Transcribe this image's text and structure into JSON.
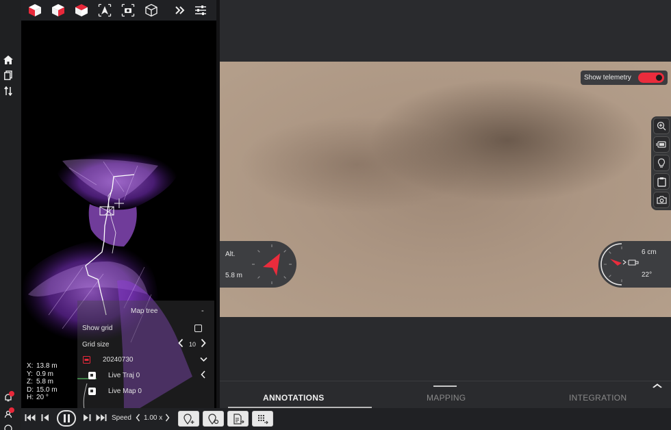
{
  "toolbar": {
    "icons": [
      "cube-red-left-icon",
      "cube-red-right-icon",
      "cube-red-top-icon",
      "navigation-arrow-icon",
      "camera-icon",
      "cube-outline-icon",
      "double-chevron-right-icon",
      "sliders-icon"
    ]
  },
  "map_tree": {
    "title": "Map tree",
    "collapse_symbol": "-",
    "show_grid_label": "Show grid",
    "grid_size_label": "Grid size",
    "grid_size_value": "10",
    "date_node": "20240730",
    "layers": [
      "Live Traj 0",
      "Live Map 0"
    ]
  },
  "coords": [
    {
      "k": "X:",
      "v": "13.8 m"
    },
    {
      "k": "Y:",
      "v": "0.9 m"
    },
    {
      "k": "Z:",
      "v": "5.8 m"
    },
    {
      "k": "D:",
      "v": "15.0 m"
    },
    {
      "k": "H:",
      "v": "20 °"
    }
  ],
  "telemetry": {
    "label": "Show telemetry",
    "enabled": true,
    "altitude_label": "Alt.",
    "altitude_value": "5.8 m",
    "distance_value": "6 cm",
    "angle_value": "22°"
  },
  "tabs": [
    {
      "label": "ANNOTATIONS",
      "active": true
    },
    {
      "label": "MAPPING",
      "active": false
    },
    {
      "label": "INTEGRATION",
      "active": false
    }
  ],
  "playback": {
    "speed_label": "Speed",
    "speed_value": "1.00 x"
  },
  "colors": {
    "accent": "#ea2c3c",
    "point_cloud": "#9b4fd8",
    "panel": "#2a2b2e"
  }
}
